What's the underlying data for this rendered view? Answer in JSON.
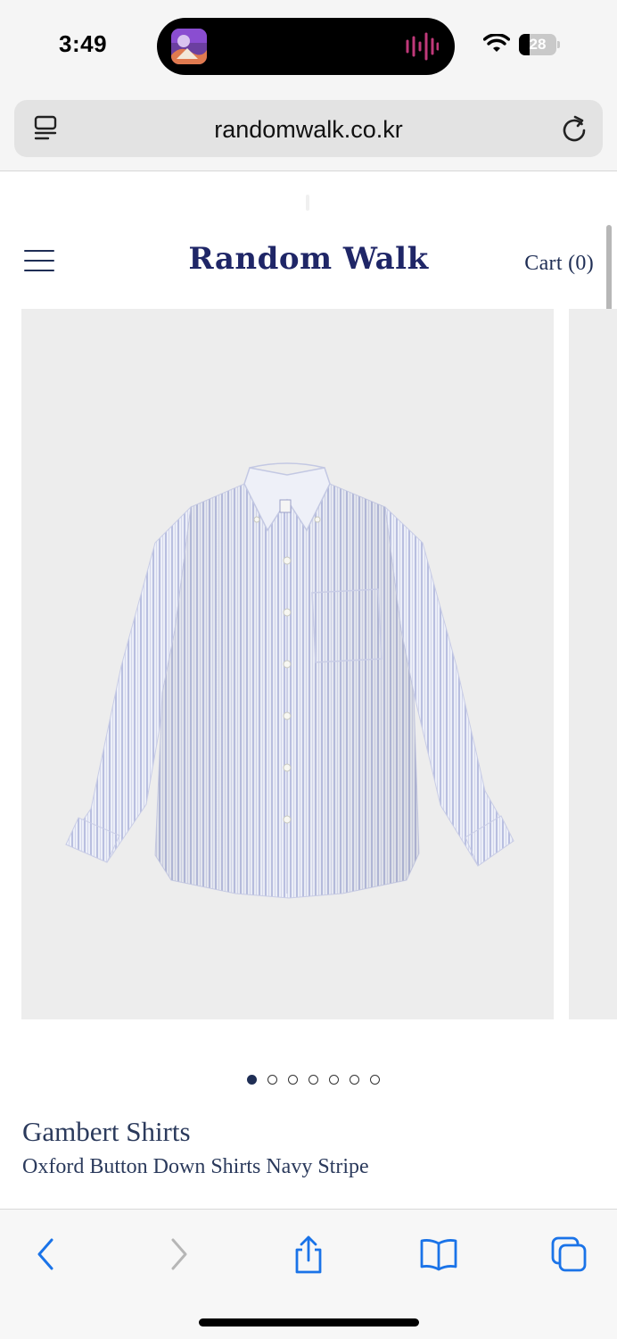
{
  "status_bar": {
    "time": "3:49",
    "battery_percent": "28",
    "battery_level": 0.28
  },
  "browser": {
    "url": "randomwalk.co.kr"
  },
  "site": {
    "brand": "Random Walk",
    "cart_label": "Cart (0)",
    "brand_color": "#1f2667"
  },
  "carousel": {
    "slide_count": 7,
    "active_index": 0,
    "image_alt": "light blue striped button-down shirt"
  },
  "product": {
    "brand": "Gambert Shirts",
    "name": "Oxford Button Down Shirts Navy Stripe"
  },
  "toolbar": {
    "items": [
      {
        "name": "back-button",
        "icon": "chevron-left-icon",
        "enabled": true
      },
      {
        "name": "forward-button",
        "icon": "chevron-right-icon",
        "enabled": false
      },
      {
        "name": "share-button",
        "icon": "share-icon",
        "enabled": true
      },
      {
        "name": "bookmarks-button",
        "icon": "book-icon",
        "enabled": true
      },
      {
        "name": "tabs-button",
        "icon": "tabs-icon",
        "enabled": true
      }
    ],
    "accent": "#1a73e8"
  }
}
